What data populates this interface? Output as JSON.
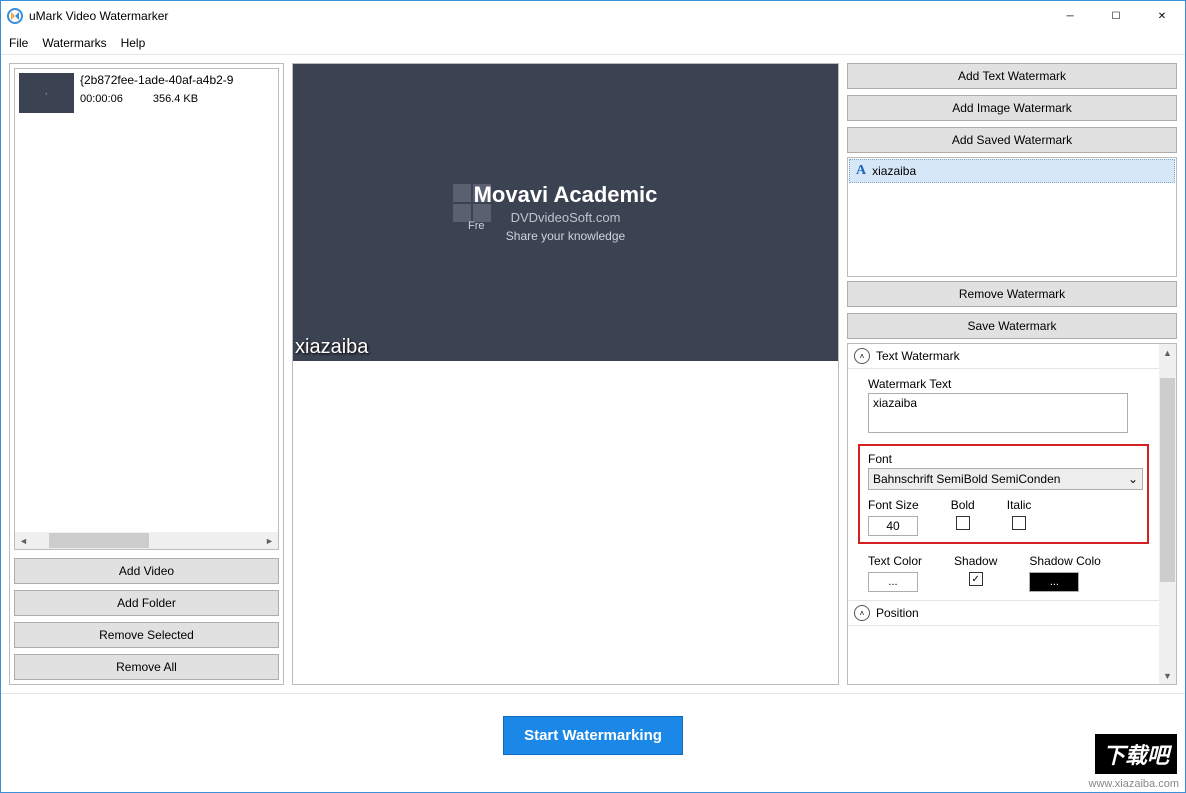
{
  "app": {
    "title": "uMark Video Watermarker"
  },
  "menu": {
    "file": "File",
    "watermarks": "Watermarks",
    "help": "Help"
  },
  "video": {
    "name": "{2b872fee-1ade-40af-a4b2-9",
    "duration": "00:00:06",
    "size": "356.4 KB"
  },
  "leftButtons": {
    "addVideo": "Add Video",
    "addFolder": "Add Folder",
    "removeSelected": "Remove Selected",
    "removeAll": "Remove All"
  },
  "preview": {
    "title": "Movavi Academic",
    "shadow": "DVDvideoSoft.com",
    "subtitle": "Share your knowledge",
    "fre": "Fre",
    "watermark": "xiazaiba"
  },
  "rightButtons": {
    "addText": "Add Text Watermark",
    "addImage": "Add Image Watermark",
    "addSaved": "Add Saved Watermark",
    "remove": "Remove Watermark",
    "save": "Save Watermark"
  },
  "wmItem": "xiazaiba",
  "props": {
    "section1": "Text Watermark",
    "watermarkTextLabel": "Watermark Text",
    "watermarkTextValue": "xiazaiba",
    "fontLabel": "Font",
    "fontValue": "Bahnschrift SemiBold SemiConden",
    "fontSizeLabel": "Font Size",
    "fontSizeValue": "40",
    "boldLabel": "Bold",
    "italicLabel": "Italic",
    "textColorLabel": "Text Color",
    "textColorBtn": "...",
    "shadowLabel": "Shadow",
    "shadowColorLabel": "Shadow Colo",
    "shadowColorBtn": "...",
    "section2": "Position"
  },
  "footer": {
    "start": "Start Watermarking"
  },
  "site": {
    "logo": "下载吧",
    "url": "www.xiazaiba.com"
  }
}
